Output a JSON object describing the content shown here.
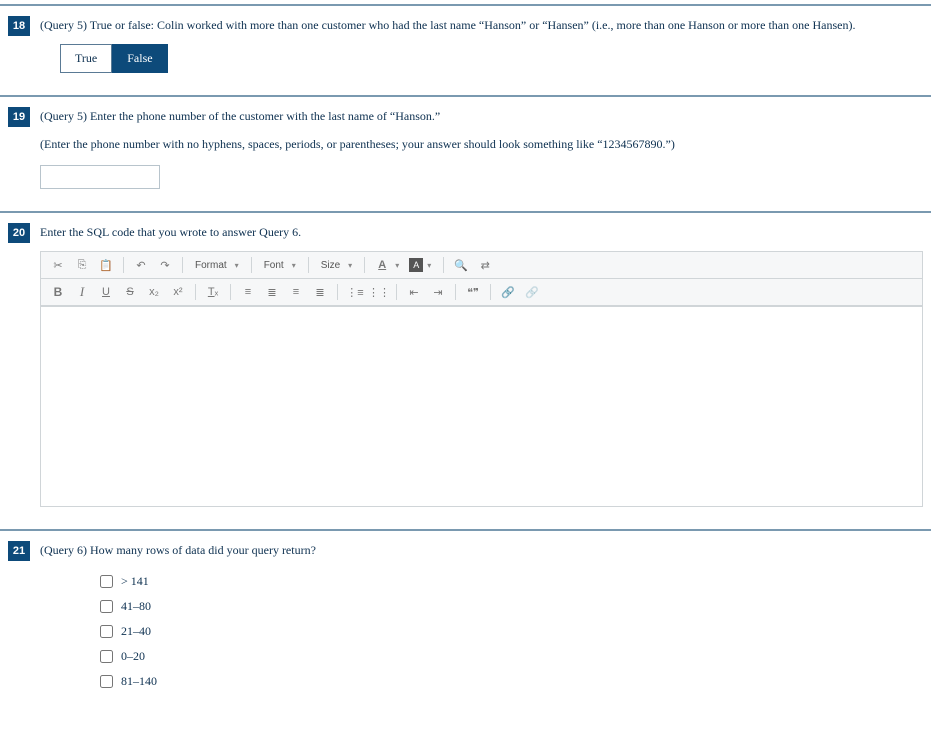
{
  "questions": {
    "q18": {
      "number": "18",
      "prompt": "(Query 5) True or false: Colin worked with more than one customer who had the last name “Hanson” or “Hansen” (i.e., more than one Hanson or more than one Hansen).",
      "true_label": "True",
      "false_label": "False",
      "selected": "False"
    },
    "q19": {
      "number": "19",
      "prompt": "(Query 5) Enter the phone number of the customer with the last name of “Hanson.”",
      "subprompt": "(Enter the phone number with no hyphens, spaces, periods, or parentheses; your answer should look something like “1234567890.”)",
      "value": ""
    },
    "q20": {
      "number": "20",
      "prompt": "Enter the SQL code that you wrote to answer Query 6.",
      "toolbar": {
        "format": "Format",
        "font": "Font",
        "size": "Size"
      }
    },
    "q21": {
      "number": "21",
      "prompt": "(Query 6) How many rows of data did your query return?",
      "options": [
        "> 141",
        "41–80",
        "21–40",
        "0–20",
        "81–140"
      ]
    }
  }
}
